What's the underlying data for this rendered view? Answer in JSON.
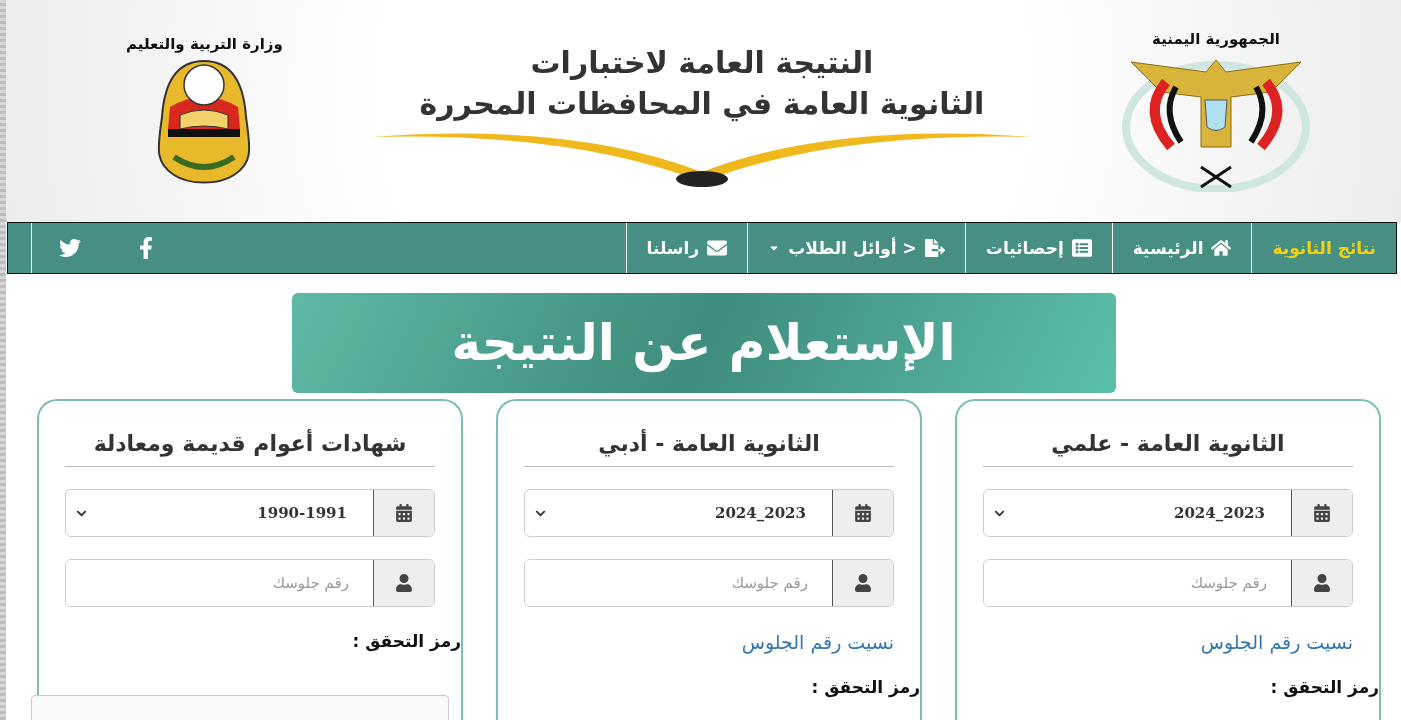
{
  "header": {
    "ministry_caption": "وزارة التربية والتعليم",
    "title_lines": [
      "النتيجة العامة لاختبارات",
      "الثانوية العامة في المحافظات المحررة"
    ],
    "republic_caption": "الجمهورية اليمنية"
  },
  "nav": {
    "items": [
      {
        "label": "نتائج الثانوية",
        "kind": "brand"
      },
      {
        "label": "الرئيسية",
        "kind": "home"
      },
      {
        "label": "إحصائيات",
        "kind": "stats"
      },
      {
        "label": "< أوائل الطلاب",
        "kind": "dropdown"
      },
      {
        "label": "راسلنا",
        "kind": "mail"
      }
    ],
    "social": [
      {
        "kind": "facebook"
      },
      {
        "kind": "twitter"
      }
    ]
  },
  "banner": {
    "title": "الإستعلام عن النتيجة"
  },
  "cards": [
    {
      "title": "الثانوية العامة - علمي",
      "year": "2024_2023",
      "seat_placeholder": "رقم جلوسك",
      "forgot_link": "نسيت رقم الجلوس",
      "captcha_label": "رمز التحقق :"
    },
    {
      "title": "الثانوية العامة - أدبي",
      "year": "2024_2023",
      "seat_placeholder": "رقم جلوسك",
      "forgot_link": "نسيت رقم الجلوس",
      "captcha_label": "رمز التحقق :"
    },
    {
      "title": "شهادات أعوام قديمة ومعادلة",
      "year": "1990-1991",
      "seat_placeholder": "رقم جلوسك",
      "captcha_label": "رمز التحقق :"
    }
  ]
}
